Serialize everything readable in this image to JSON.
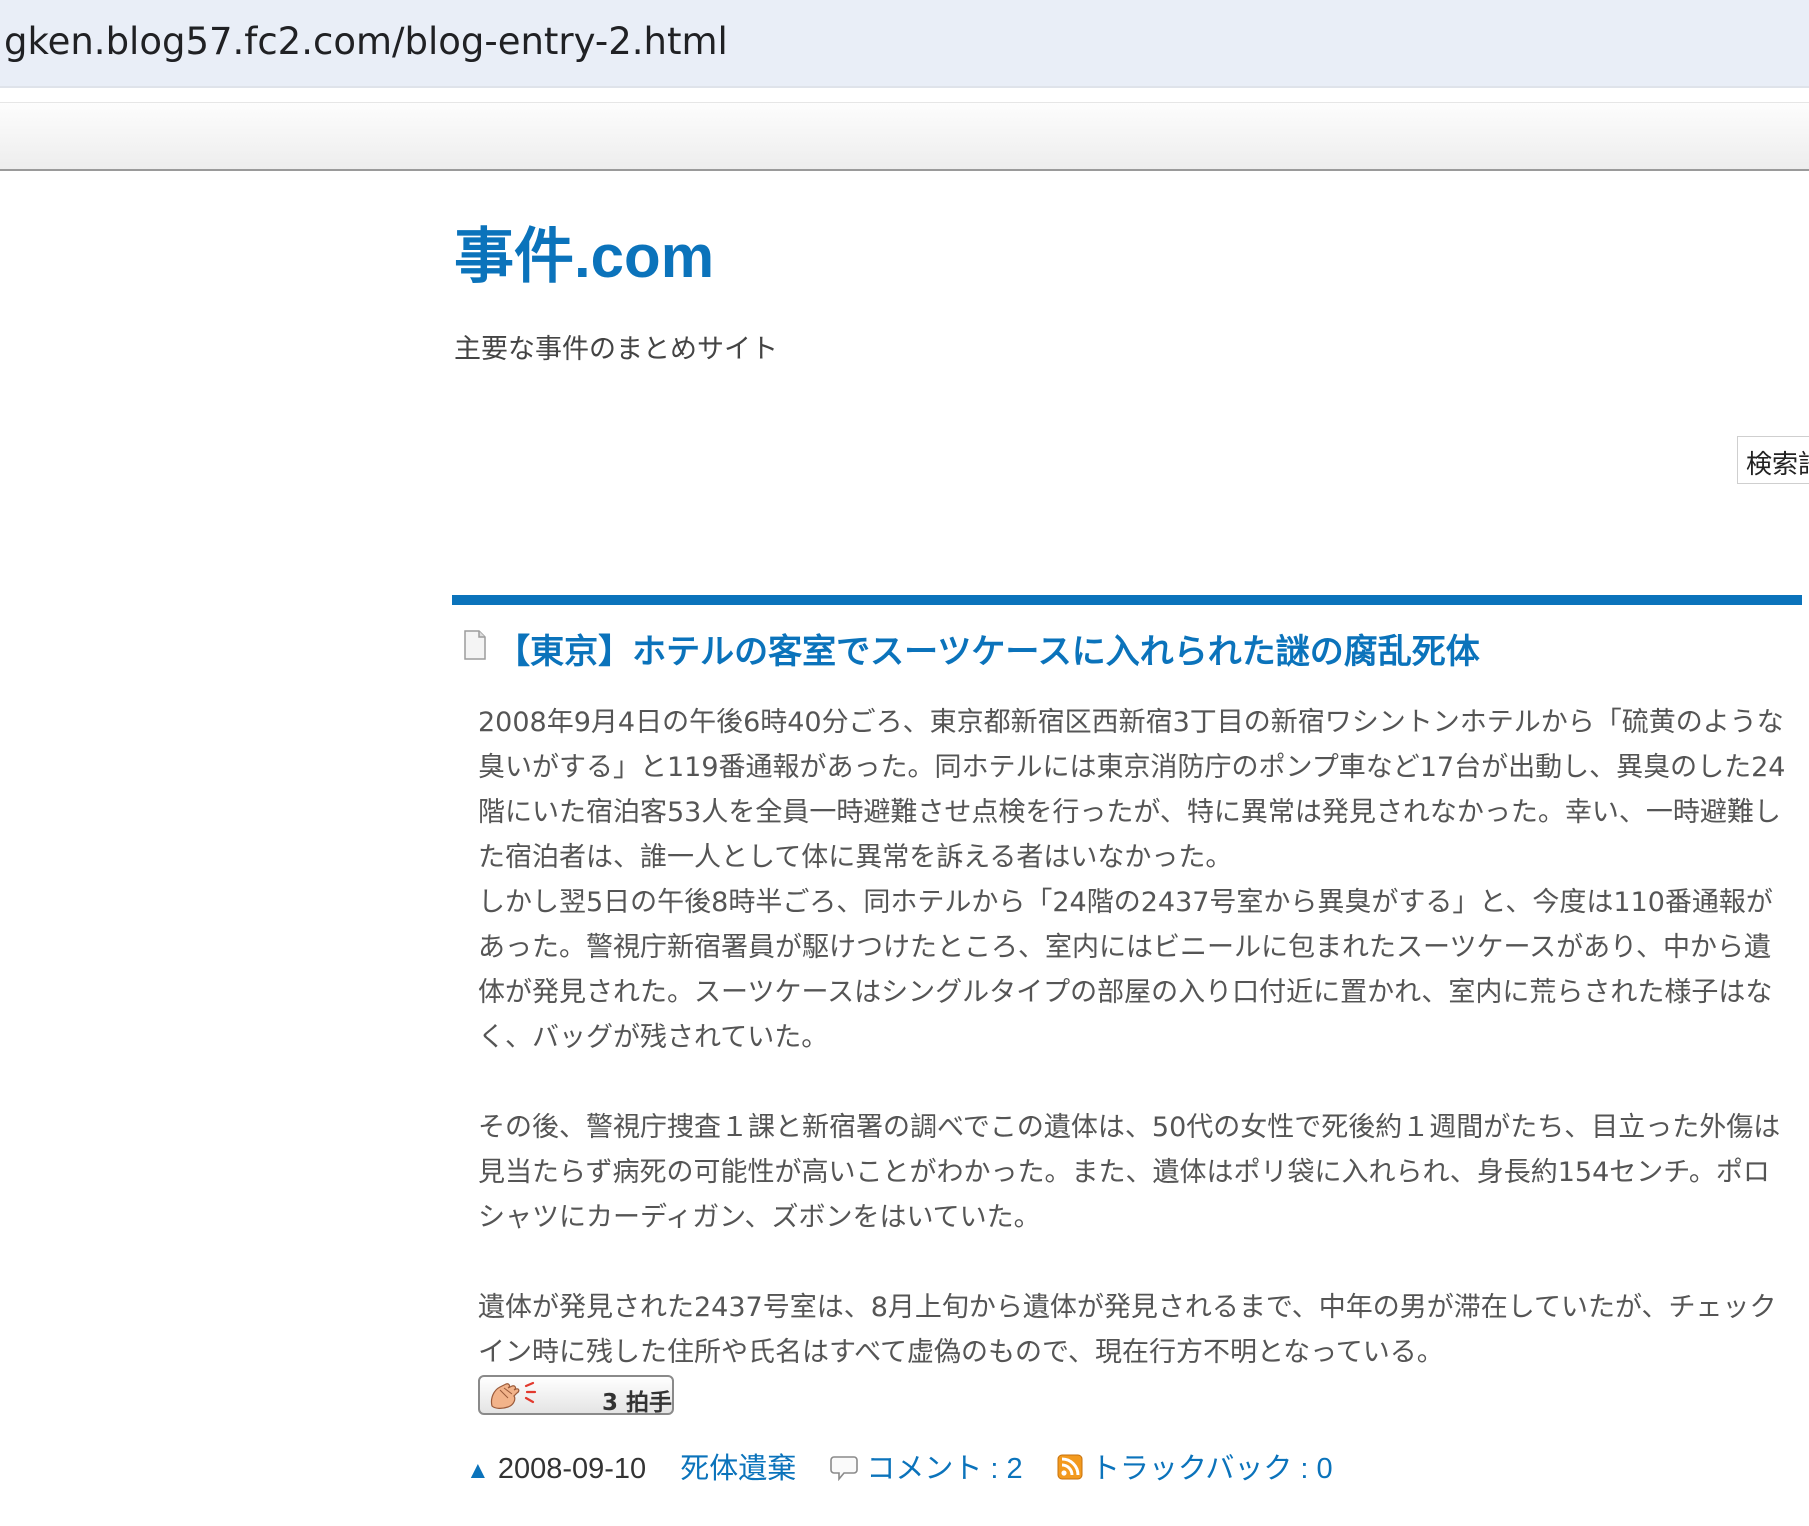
{
  "browser": {
    "url": "gken.blog57.fc2.com/blog-entry-2.html"
  },
  "blog": {
    "title": "事件.com",
    "description": "主要な事件のまとめサイト"
  },
  "search": {
    "label": "検索語"
  },
  "entry": {
    "title": "【東京】ホテルの客室でスーツケースに入れられた謎の腐乱死体",
    "paragraph1": "2008年9月4日の午後6時40分ごろ、東京都新宿区西新宿3丁目の新宿ワシントンホテルから「硫黄のような臭いがする」と119番通報があった。同ホテルには東京消防庁のポンプ車など17台が出動し、異臭のした24階にいた宿泊客53人を全員一時避難させ点検を行ったが、特に異常は発見されなかった。幸い、一時避難した宿泊者は、誰一人として体に異常を訴える者はいなかった。",
    "paragraph2": "しかし翌5日の午後8時半ごろ、同ホテルから「24階の2437号室から異臭がする」と、今度は110番通報があった。警視庁新宿署員が駆けつけたところ、室内にはビニールに包まれたスーツケースがあり、中から遺体が発見された。スーツケースはシングルタイプの部屋の入り口付近に置かれ、室内に荒らされた様子はなく、バッグが残されていた。",
    "paragraph3": "その後、警視庁捜査１課と新宿署の調べでこの遺体は、50代の女性で死後約１週間がたち、目立った外傷は見当たらず病死の可能性が高いことがわかった。また、遺体はポリ袋に入れられ、身長約154センチ。ポロシャツにカーディガン、ズボンをはいていた。",
    "paragraph4": "遺体が発見された2437号室は、8月上旬から遺体が発見されるまで、中年の男が滞在していたが、チェックイン時に残した住所や氏名はすべて虚偽のもので、現在行方不明となっている。",
    "clap": {
      "count": "3",
      "label": "拍手"
    },
    "footer": {
      "top_arrow": "▲",
      "date": "2008-09-10",
      "category": "死体遺棄",
      "comments": "コメント : 2",
      "trackbacks": "トラックバック : 0"
    }
  },
  "icons": {
    "document": "document-icon",
    "comment": "comment-bubble-icon",
    "rss": "rss-icon",
    "clap": "clapping-hands-icon"
  },
  "colors": {
    "link_blue": "#0b73bb",
    "text_gray": "#555555",
    "rss_orange": "#f39a1e"
  }
}
